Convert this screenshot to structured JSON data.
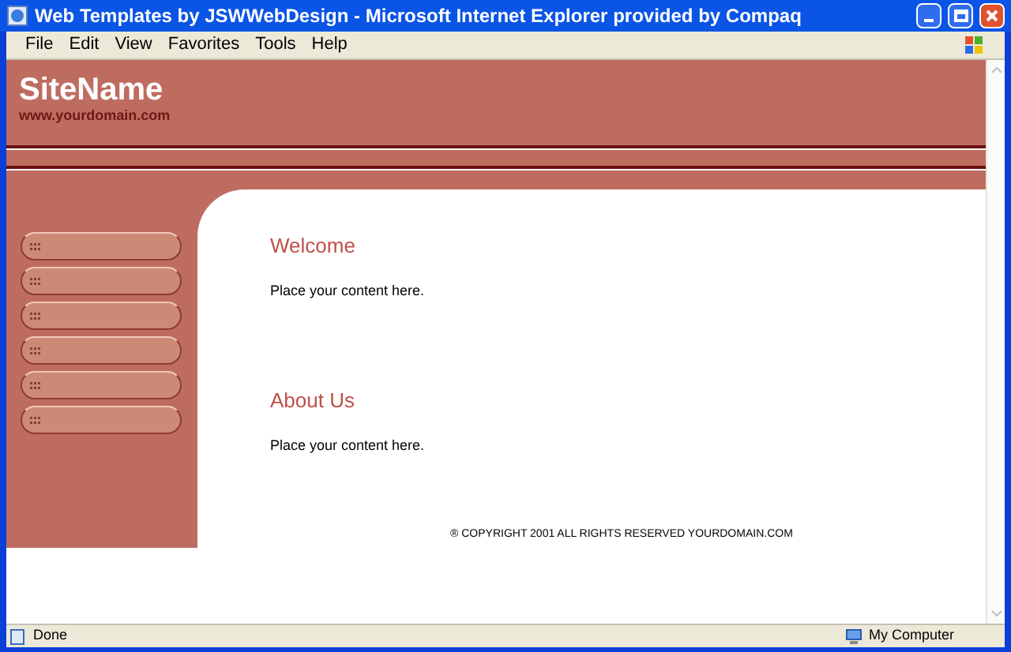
{
  "window": {
    "title": "Web Templates by JSWWebDesign - Microsoft Internet Explorer provided by Compaq"
  },
  "menu": [
    "File",
    "Edit",
    "View",
    "Favorites",
    "Tools",
    "Help"
  ],
  "header": {
    "site_name": "SiteName",
    "domain": "www.yourdomain.com"
  },
  "nav_buttons": [
    {
      "kind": "pill"
    },
    {
      "kind": "pill"
    },
    {
      "kind": "pill"
    },
    {
      "kind": "pill"
    },
    {
      "kind": "pill"
    },
    {
      "kind": "pill"
    }
  ],
  "sections": [
    {
      "heading": "Welcome",
      "text": "Place your content here."
    },
    {
      "heading": "About Us",
      "text": "Place your content here."
    }
  ],
  "footer": "® COPYRIGHT 2001 ALL RIGHTS RESERVED YOURDOMAIN.COM",
  "status_bar": {
    "status": "Done",
    "zone": "My Computer"
  }
}
